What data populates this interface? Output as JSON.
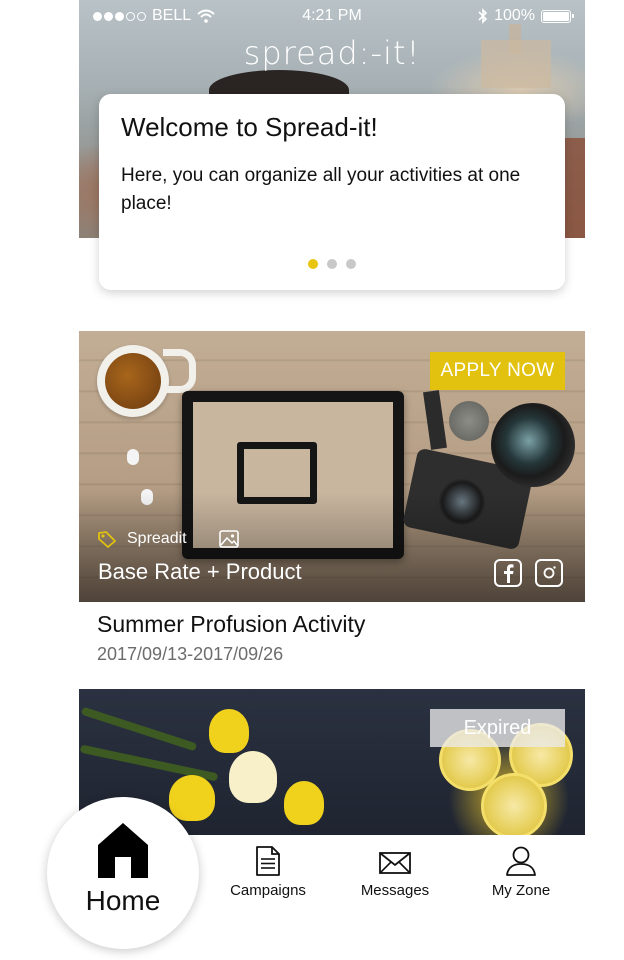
{
  "status_bar": {
    "carrier": "BELL",
    "time": "4:21 PM",
    "battery": "100%"
  },
  "hero": {
    "logo_text": "spread:-it!"
  },
  "welcome": {
    "title": "Welcome to Spread-it!",
    "text": "Here, you can organize all your activities at one place!",
    "pager": {
      "total": 3,
      "active_index": 0
    }
  },
  "campaigns": [
    {
      "action_label": "APPLY NOW",
      "brand": "Spreadit",
      "rate": "Base Rate + Product",
      "title": "Summer Profusion Activity",
      "dates": "2017/09/13-2017/09/26",
      "social": [
        "facebook",
        "instagram"
      ]
    },
    {
      "status_label": "Expired"
    }
  ],
  "tabbar": {
    "home": "Home",
    "campaigns": "Campaigns",
    "messages": "Messages",
    "my_zone": "My Zone"
  },
  "colors": {
    "accent": "#e2c10f",
    "pager_inactive": "#c8c8c8",
    "muted_text": "#6c6c6c"
  }
}
